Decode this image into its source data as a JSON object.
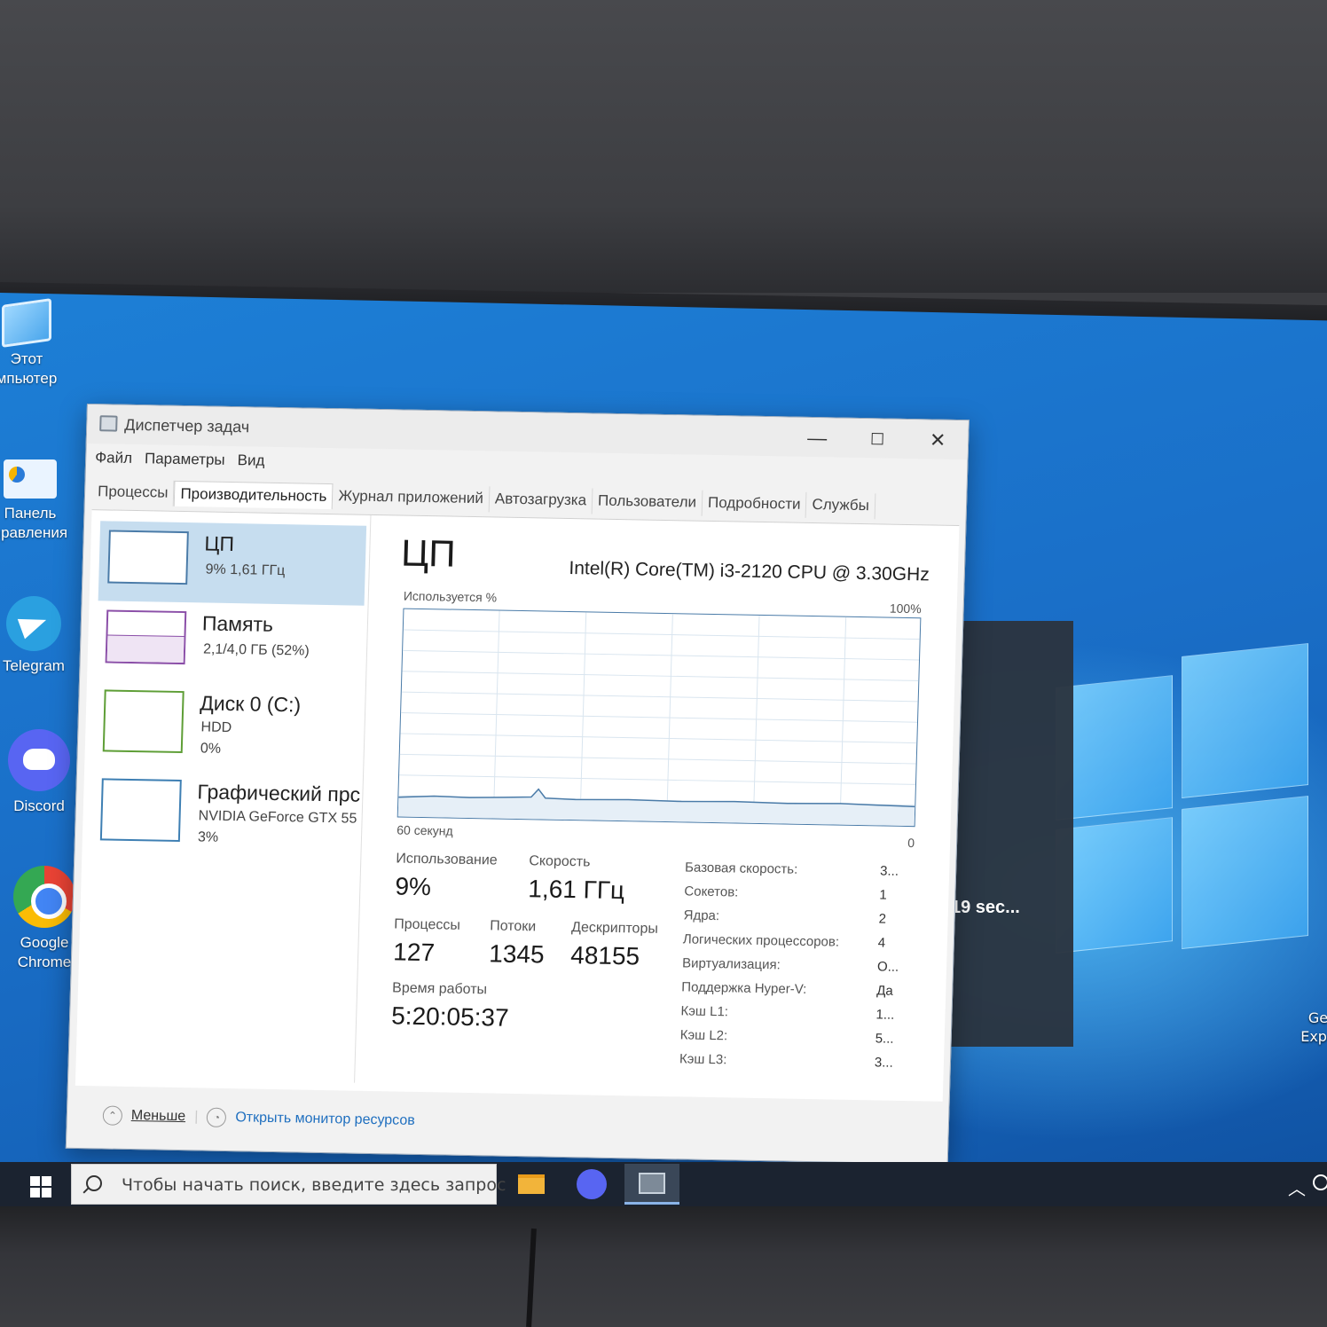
{
  "desktop": {
    "icons": [
      {
        "label": "Этот\nмпьютер",
        "icon": "this-pc-icon"
      },
      {
        "label": "Панель\nправления",
        "icon": "control-panel-icon"
      },
      {
        "label": "Telegram",
        "icon": "telegram-icon"
      },
      {
        "label": "Discord",
        "icon": "discord-icon"
      },
      {
        "label": "Google\nChrome",
        "icon": "chrome-icon"
      }
    ],
    "notification_text": "19 sec...",
    "edge_icon_label": "Ge\nExpe"
  },
  "window": {
    "title": "Диспетчер задач",
    "menu": [
      "Файл",
      "Параметры",
      "Вид"
    ],
    "tabs": [
      "Процессы",
      "Производительность",
      "Журнал приложений",
      "Автозагрузка",
      "Пользователи",
      "Подробности",
      "Службы"
    ],
    "active_tab": "Производительность"
  },
  "sidebar": {
    "items": [
      {
        "name": "ЦП",
        "sub1": "9%  1,61 ГГц",
        "sub2": ""
      },
      {
        "name": "Память",
        "sub1": "2,1/4,0 ГБ (52%)",
        "sub2": ""
      },
      {
        "name": "Диск 0 (C:)",
        "sub1": "HDD",
        "sub2": "0%"
      },
      {
        "name": "Графический прс",
        "sub1": "NVIDIA GeForce GTX 55",
        "sub2": "3%"
      }
    ]
  },
  "cpu": {
    "title": "ЦП",
    "model": "Intel(R) Core(TM) i3-2120 CPU @ 3.30GHz",
    "graph_label": "Используется %",
    "graph_max": "100%",
    "graph_time": "60 секунд",
    "graph_min": "0",
    "usage_label": "Использование",
    "usage": "9%",
    "speed_label": "Скорость",
    "speed": "1,61 ГГц",
    "processes_label": "Процессы",
    "processes": "127",
    "threads_label": "Потоки",
    "threads": "1345",
    "handles_label": "Дескрипторы",
    "handles": "48155",
    "uptime_label": "Время работы",
    "uptime": "5:20:05:37",
    "specs": [
      {
        "k": "Базовая скорость:",
        "v": "3..."
      },
      {
        "k": "Сокетов:",
        "v": "1"
      },
      {
        "k": "Ядра:",
        "v": "2"
      },
      {
        "k": "Логических процессоров:",
        "v": "4"
      },
      {
        "k": "Виртуализация:",
        "v": "О..."
      },
      {
        "k": "Поддержка Hyper-V:",
        "v": "Да"
      },
      {
        "k": "Кэш L1:",
        "v": "1..."
      },
      {
        "k": "Кэш L2:",
        "v": "5..."
      },
      {
        "k": "Кэш L3:",
        "v": "3..."
      }
    ]
  },
  "footer": {
    "less": "Меньше",
    "resource_monitor": "Открыть монитор ресурсов"
  },
  "taskbar": {
    "search_placeholder": "Чтобы начать поиск, введите здесь запрос"
  }
}
